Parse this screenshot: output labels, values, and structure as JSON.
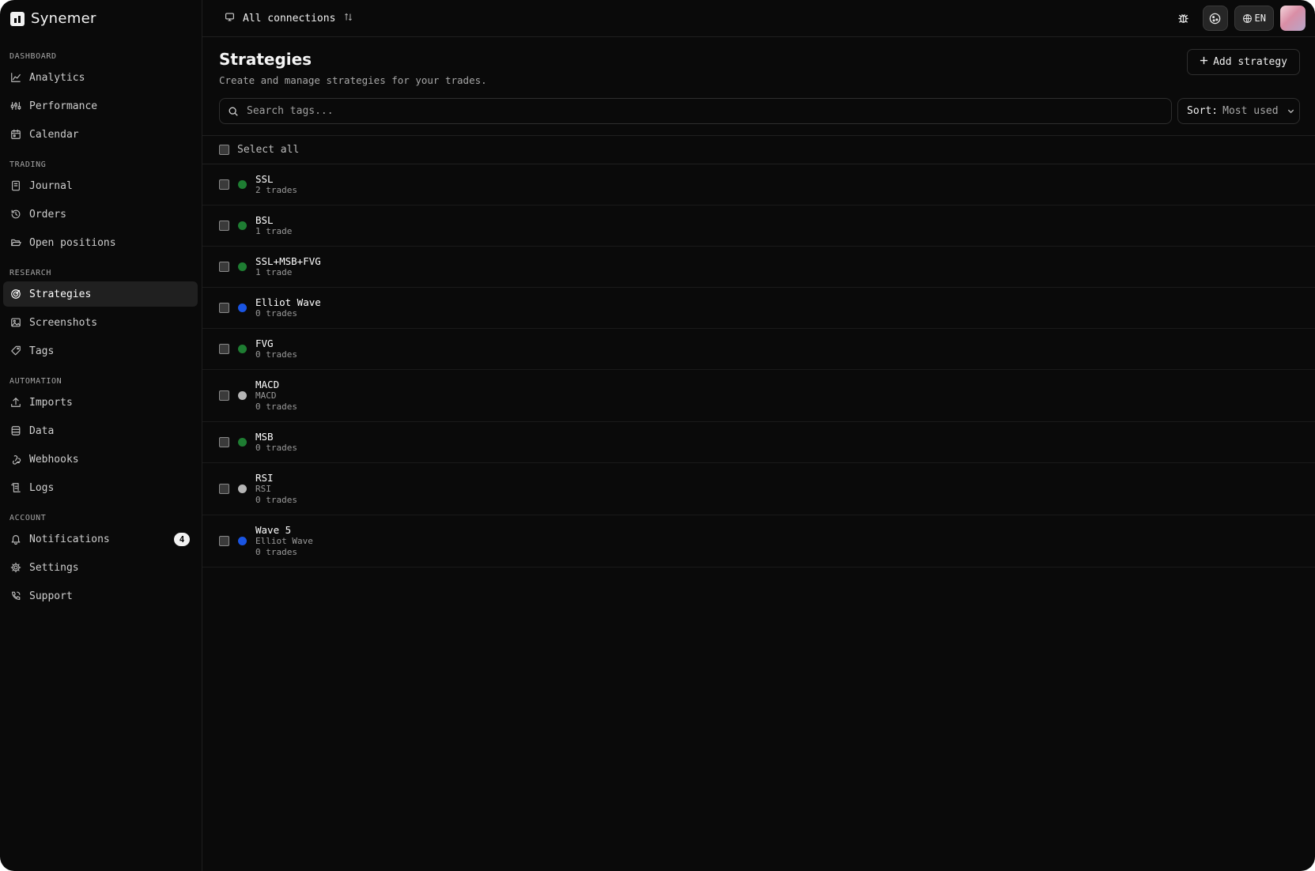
{
  "brand": {
    "name": "Synemer"
  },
  "sidebar": {
    "sections": [
      {
        "title": "DASHBOARD",
        "items": [
          {
            "label": "Analytics",
            "icon": "chart-line-icon"
          },
          {
            "label": "Performance",
            "icon": "performance-icon"
          },
          {
            "label": "Calendar",
            "icon": "calendar-icon"
          }
        ]
      },
      {
        "title": "TRADING",
        "items": [
          {
            "label": "Journal",
            "icon": "journal-icon"
          },
          {
            "label": "Orders",
            "icon": "history-icon"
          },
          {
            "label": "Open positions",
            "icon": "folder-open-icon"
          }
        ]
      },
      {
        "title": "RESEARCH",
        "items": [
          {
            "label": "Strategies",
            "icon": "target-icon",
            "active": true
          },
          {
            "label": "Screenshots",
            "icon": "image-icon"
          },
          {
            "label": "Tags",
            "icon": "tag-icon"
          }
        ]
      },
      {
        "title": "AUTOMATION",
        "items": [
          {
            "label": "Imports",
            "icon": "upload-icon"
          },
          {
            "label": "Data",
            "icon": "database-icon"
          },
          {
            "label": "Webhooks",
            "icon": "webhook-icon"
          },
          {
            "label": "Logs",
            "icon": "logs-icon"
          }
        ]
      },
      {
        "title": "ACCOUNT",
        "items": [
          {
            "label": "Notifications",
            "icon": "bell-icon",
            "badge": "4"
          },
          {
            "label": "Settings",
            "icon": "gear-icon"
          },
          {
            "label": "Support",
            "icon": "phone-icon"
          }
        ]
      }
    ]
  },
  "topbar": {
    "connection_label": "All connections",
    "lang_label": "EN"
  },
  "page": {
    "title": "Strategies",
    "subtitle": "Create and manage strategies for your trades.",
    "add_button": "Add strategy",
    "search_placeholder": "Search tags...",
    "sort_label": "Sort:",
    "sort_value": "Most used",
    "select_all": "Select all"
  },
  "strategies": [
    {
      "name": "SSL",
      "parent": "",
      "trades": "2 trades",
      "color": "#1e7d32"
    },
    {
      "name": "BSL",
      "parent": "",
      "trades": "1 trade",
      "color": "#1e7d32"
    },
    {
      "name": "SSL+MSB+FVG",
      "parent": "",
      "trades": "1 trade",
      "color": "#1e7d32"
    },
    {
      "name": "Elliot Wave",
      "parent": "",
      "trades": "0 trades",
      "color": "#1a55e3"
    },
    {
      "name": "FVG",
      "parent": "",
      "trades": "0 trades",
      "color": "#1e7d32"
    },
    {
      "name": "MACD",
      "parent": "MACD",
      "trades": "0 trades",
      "color": "#b5b5b5"
    },
    {
      "name": "MSB",
      "parent": "",
      "trades": "0 trades",
      "color": "#1e7d32"
    },
    {
      "name": "RSI",
      "parent": "RSI",
      "trades": "0 trades",
      "color": "#b5b5b5"
    },
    {
      "name": "Wave 5",
      "parent": "Elliot Wave",
      "trades": "0 trades",
      "color": "#1a55e3"
    }
  ]
}
